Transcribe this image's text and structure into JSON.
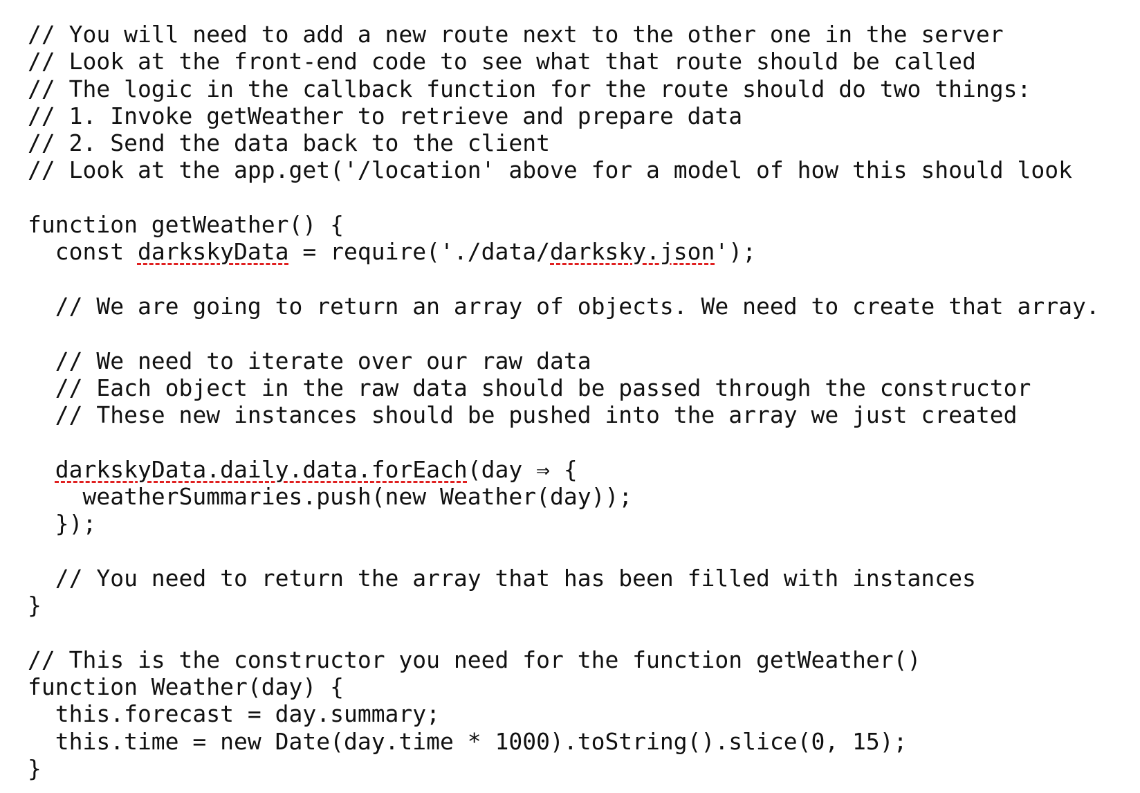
{
  "editor": {
    "lines": [
      {
        "segments": [
          {
            "text": "// You will need to add a new route next to the other one in the server"
          }
        ]
      },
      {
        "segments": [
          {
            "text": "// Look at the front-end code to see what that route should be called"
          }
        ]
      },
      {
        "segments": [
          {
            "text": "// The logic in the callback function for the route should do two things:"
          }
        ]
      },
      {
        "segments": [
          {
            "text": "// 1. Invoke getWeather to retrieve and prepare data"
          }
        ]
      },
      {
        "segments": [
          {
            "text": "// 2. Send the data back to the client"
          }
        ]
      },
      {
        "segments": [
          {
            "text": "// Look at the app.get('/location' above for a model of how this should look"
          }
        ]
      },
      {
        "segments": [
          {
            "text": ""
          }
        ]
      },
      {
        "segments": [
          {
            "text": "function getWeather() {"
          }
        ]
      },
      {
        "segments": [
          {
            "text": "  const "
          },
          {
            "text": "darkskyData",
            "error": true
          },
          {
            "text": " = require('./data/"
          },
          {
            "text": "darksky.json",
            "error": true
          },
          {
            "text": "');"
          }
        ]
      },
      {
        "segments": [
          {
            "text": ""
          }
        ]
      },
      {
        "segments": [
          {
            "text": "  // We are going to return an array of objects. We need to create that array."
          }
        ]
      },
      {
        "segments": [
          {
            "text": ""
          }
        ]
      },
      {
        "segments": [
          {
            "text": "  // We need to iterate over our raw data"
          }
        ]
      },
      {
        "segments": [
          {
            "text": "  // Each object in the raw data should be passed through the constructor"
          }
        ]
      },
      {
        "segments": [
          {
            "text": "  // These new instances should be pushed into the array we just created"
          }
        ]
      },
      {
        "segments": [
          {
            "text": ""
          }
        ]
      },
      {
        "segments": [
          {
            "text": "  "
          },
          {
            "text": "darkskyData.daily.data.forEach",
            "error": true
          },
          {
            "text": "(day ⇒ {"
          }
        ]
      },
      {
        "segments": [
          {
            "text": "    weatherSummaries.push(new Weather(day));"
          }
        ]
      },
      {
        "segments": [
          {
            "text": "  });"
          }
        ]
      },
      {
        "segments": [
          {
            "text": ""
          }
        ]
      },
      {
        "segments": [
          {
            "text": "  // You need to return the array that has been filled with instances"
          }
        ]
      },
      {
        "segments": [
          {
            "text": "}"
          }
        ]
      },
      {
        "segments": [
          {
            "text": ""
          }
        ]
      },
      {
        "segments": [
          {
            "text": "// This is the constructor you need for the function getWeather()"
          }
        ]
      },
      {
        "segments": [
          {
            "text": "function Weather(day) {"
          }
        ]
      },
      {
        "segments": [
          {
            "text": "  this.forecast = day.summary;"
          }
        ]
      },
      {
        "segments": [
          {
            "text": "  this.time = new Date(day.time * 1000).toString().slice(0, 15);"
          }
        ]
      },
      {
        "segments": [
          {
            "text": "}"
          }
        ]
      }
    ]
  },
  "colors": {
    "text": "#111111",
    "background": "#ffffff",
    "error_underline": "#e02020"
  }
}
